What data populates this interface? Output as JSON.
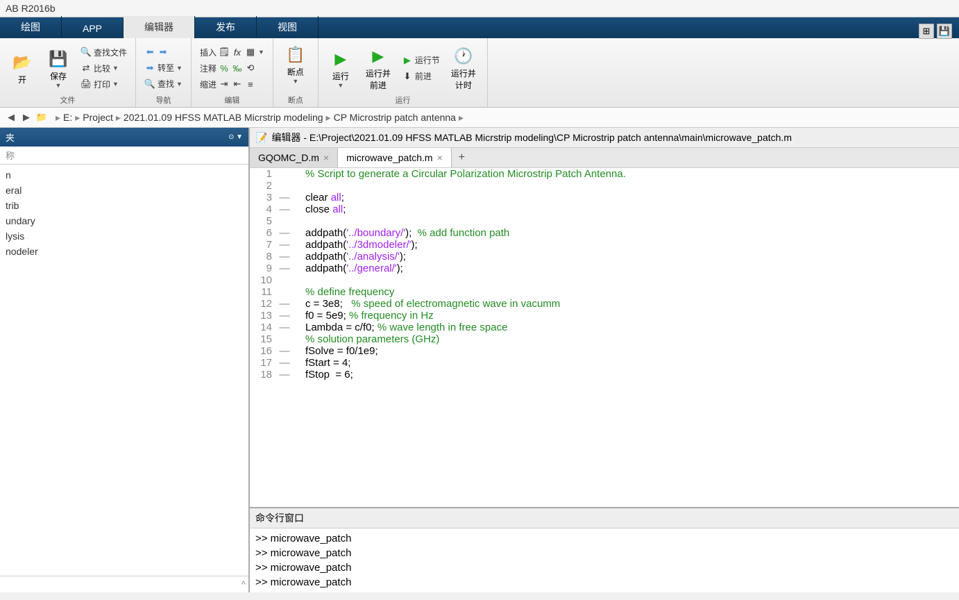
{
  "app_title": "AB R2016b",
  "main_tabs": {
    "plot": "绘图",
    "app": "APP",
    "editor": "编辑器",
    "publish": "发布",
    "view": "视图"
  },
  "ribbon": {
    "file": {
      "open": "开",
      "save": "保存",
      "find_files": "查找文件",
      "compare": "比较",
      "print": "打印",
      "label": "文件"
    },
    "nav": {
      "goto": "转至",
      "find": "查找",
      "label": "导航"
    },
    "edit": {
      "insert": "插入",
      "comment": "注释",
      "indent": "缩进",
      "label": "编辑"
    },
    "breakpoints": {
      "bp": "断点",
      "label": "断点"
    },
    "run": {
      "run": "运行",
      "run_advance": "运行并\n前进",
      "run_section": "运行节",
      "advance": "前进",
      "run_time": "运行并\n计时",
      "label": "运行"
    }
  },
  "breadcrumb": [
    "E:",
    "Project",
    "2021.01.09 HFSS MATLAB Micrstrip modeling",
    "CP Microstrip patch antenna"
  ],
  "left_panel": {
    "title": "夹",
    "subtitle": "称",
    "items": [
      "n",
      "eral",
      "trib",
      "undary",
      "lysis",
      "nodeler"
    ]
  },
  "editor": {
    "title": "编辑器 - E:\\Project\\2021.01.09 HFSS MATLAB Micrstrip modeling\\CP Microstrip patch antenna\\main\\microwave_patch.m",
    "tabs": [
      {
        "name": "GQOMC_D.m",
        "active": false
      },
      {
        "name": "microwave_patch.m",
        "active": true
      }
    ]
  },
  "code": [
    {
      "n": 1,
      "dash": "",
      "tokens": [
        {
          "t": "comment",
          "v": "% Script to generate a Circular Polarization Microstrip Patch Antenna."
        }
      ]
    },
    {
      "n": 2,
      "dash": "",
      "tokens": []
    },
    {
      "n": 3,
      "dash": "—",
      "tokens": [
        {
          "t": "plain",
          "v": "clear "
        },
        {
          "t": "string",
          "v": "all"
        },
        {
          "t": "plain",
          "v": ";"
        }
      ]
    },
    {
      "n": 4,
      "dash": "—",
      "tokens": [
        {
          "t": "plain",
          "v": "close "
        },
        {
          "t": "string",
          "v": "all"
        },
        {
          "t": "plain",
          "v": ";"
        }
      ]
    },
    {
      "n": 5,
      "dash": "",
      "tokens": []
    },
    {
      "n": 6,
      "dash": "—",
      "tokens": [
        {
          "t": "plain",
          "v": "addpath("
        },
        {
          "t": "string",
          "v": "'../boundary/'"
        },
        {
          "t": "plain",
          "v": ");  "
        },
        {
          "t": "comment",
          "v": "% add function path"
        }
      ]
    },
    {
      "n": 7,
      "dash": "—",
      "tokens": [
        {
          "t": "plain",
          "v": "addpath("
        },
        {
          "t": "string",
          "v": "'../3dmodeler/'"
        },
        {
          "t": "plain",
          "v": ");"
        }
      ]
    },
    {
      "n": 8,
      "dash": "—",
      "tokens": [
        {
          "t": "plain",
          "v": "addpath("
        },
        {
          "t": "string",
          "v": "'../analysis/'"
        },
        {
          "t": "plain",
          "v": ");"
        }
      ]
    },
    {
      "n": 9,
      "dash": "—",
      "tokens": [
        {
          "t": "plain",
          "v": "addpath("
        },
        {
          "t": "string",
          "v": "'../general/'"
        },
        {
          "t": "plain",
          "v": ");"
        }
      ]
    },
    {
      "n": 10,
      "dash": "",
      "tokens": []
    },
    {
      "n": 11,
      "dash": "",
      "tokens": [
        {
          "t": "comment",
          "v": "% define frequency"
        }
      ]
    },
    {
      "n": 12,
      "dash": "—",
      "tokens": [
        {
          "t": "plain",
          "v": "c = 3e8;   "
        },
        {
          "t": "comment",
          "v": "% speed of electromagnetic wave in vacumm"
        }
      ]
    },
    {
      "n": 13,
      "dash": "—",
      "tokens": [
        {
          "t": "plain",
          "v": "f0 = 5e9; "
        },
        {
          "t": "comment",
          "v": "% frequency in Hz"
        }
      ]
    },
    {
      "n": 14,
      "dash": "—",
      "tokens": [
        {
          "t": "plain",
          "v": "Lambda = c/f0; "
        },
        {
          "t": "comment",
          "v": "% wave length in free space"
        }
      ]
    },
    {
      "n": 15,
      "dash": "",
      "tokens": [
        {
          "t": "comment",
          "v": "% solution parameters (GHz)"
        }
      ]
    },
    {
      "n": 16,
      "dash": "—",
      "tokens": [
        {
          "t": "plain",
          "v": "fSolve = f0/1e9;"
        }
      ]
    },
    {
      "n": 17,
      "dash": "—",
      "tokens": [
        {
          "t": "plain",
          "v": "fStart = 4;"
        }
      ]
    },
    {
      "n": 18,
      "dash": "—",
      "tokens": [
        {
          "t": "plain",
          "v": "fStop  = 6;"
        }
      ]
    }
  ],
  "command_window": {
    "title": "命令行窗口",
    "lines": [
      ">> microwave_patch",
      ">> microwave_patch",
      ">> microwave_patch",
      ">> microwave_patch"
    ]
  }
}
